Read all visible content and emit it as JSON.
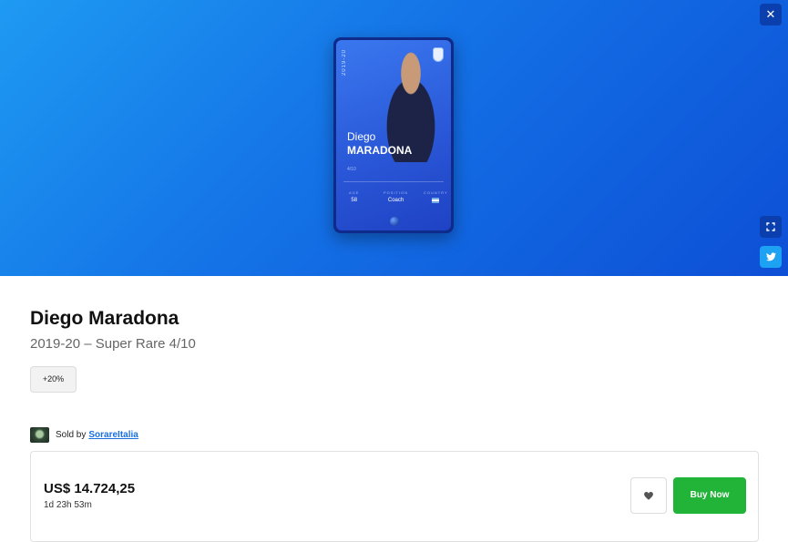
{
  "hero": {
    "close_icon": "close-icon",
    "fullscreen_icon": "fullscreen-icon",
    "twitter_icon": "twitter-icon"
  },
  "card": {
    "season": "2019-20",
    "first_name": "Diego",
    "last_name": "MARADONA",
    "serial": "4/10",
    "stats": [
      {
        "label": "AGE",
        "value": "58"
      },
      {
        "label": "POSITION",
        "value": "Coach"
      },
      {
        "label": "COUNTRY",
        "value": ""
      }
    ]
  },
  "title": "Diego Maradona",
  "subtitle": "2019-20 – Super Rare 4/10",
  "bonus": "+20%",
  "seller": {
    "label": "Sold by",
    "name": "SorareItalia"
  },
  "offer": {
    "price": "US$ 14.724,25",
    "time_left": "1d 23h 53m",
    "buy_label": "Buy Now",
    "favorite_icon": "heart-icon"
  },
  "colors": {
    "hero_start": "#1e9af2",
    "hero_end": "#0d4fd6",
    "buy_green": "#22b339",
    "link_blue": "#1a6fe0"
  }
}
